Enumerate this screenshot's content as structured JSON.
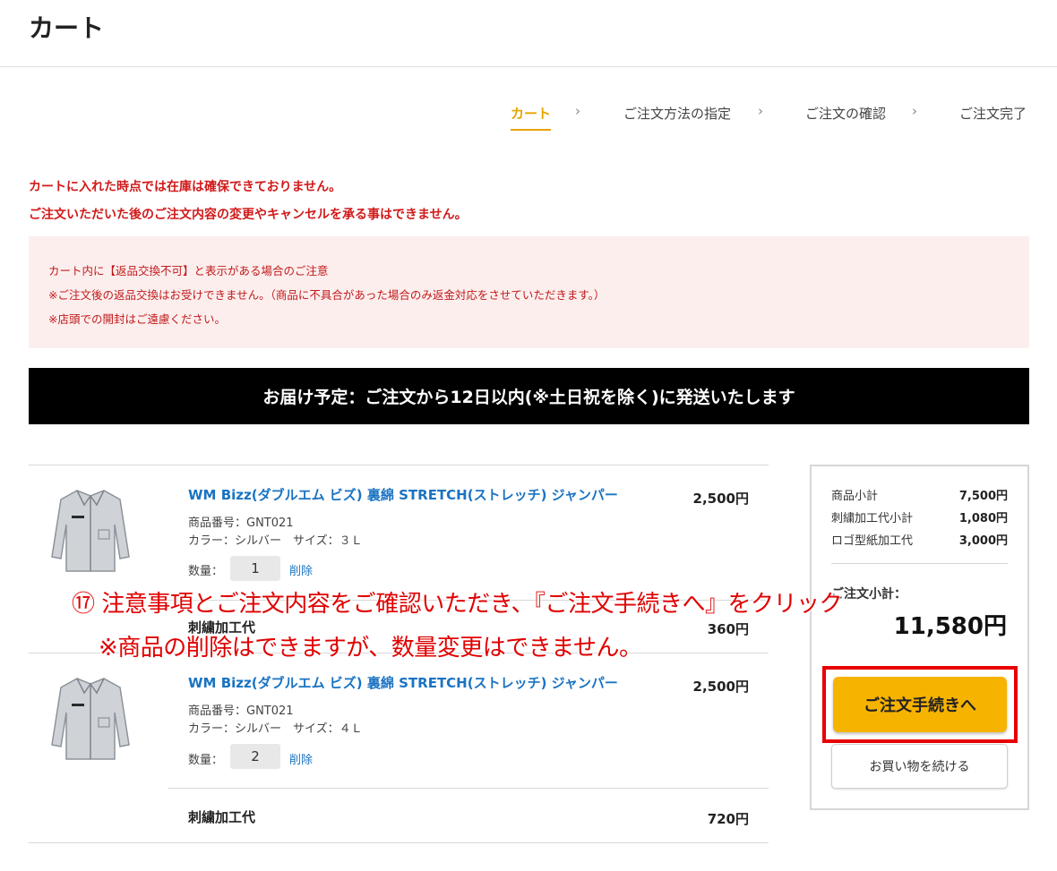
{
  "header": {
    "title": "カート"
  },
  "steps": [
    {
      "label": "カート",
      "active": true
    },
    {
      "label": "ご注文方法の指定",
      "active": false
    },
    {
      "label": "ご注文の確認",
      "active": false
    },
    {
      "label": "ご注文完了",
      "active": false
    }
  ],
  "notices": [
    "カートに入れた時点では在庫は確保できておりません。",
    "ご注文いただいた後のご注文内容の変更やキャンセルを承る事はできません。"
  ],
  "return_notice": {
    "title": "カート内に【返品交換不可】と表示がある場合のご注意",
    "lines": [
      "※ご注文後の返品交換はお受けできません。（商品に不具合があった場合のみ返金対応をさせていただきます。）",
      "※店頭での開封はご遠慮ください。"
    ]
  },
  "delivery": {
    "text": "お届け予定：ご注文から12日以内(※土日祝を除く)に発送いたします"
  },
  "items": [
    {
      "name": "WM Bizz(ダブルエム ビズ) 裏綿 STRETCH(ストレッチ) ジャンパー",
      "price": "2,500円",
      "product_code": "商品番号：GNT021",
      "color_size": "カラー：シルバー　サイズ：３Ｌ",
      "qty_label": "数量：",
      "qty": "1",
      "delete_label": "削除",
      "embroidery_label": "刺繍加工代",
      "embroidery_price": "360円"
    },
    {
      "name": "WM Bizz(ダブルエム ビズ) 裏綿 STRETCH(ストレッチ) ジャンパー",
      "price": "2,500円",
      "product_code": "商品番号：GNT021",
      "color_size": "カラー：シルバー　サイズ：４Ｌ",
      "qty_label": "数量：",
      "qty": "2",
      "delete_label": "削除",
      "embroidery_label": "刺繍加工代",
      "embroidery_price": "720円"
    }
  ],
  "summary": {
    "rows": [
      {
        "label": "商品小計",
        "value": "7,500円"
      },
      {
        "label": "刺繍加工代小計",
        "value": "1,080円"
      },
      {
        "label": "ロゴ型紙加工代",
        "value": "3,000円"
      }
    ],
    "total_label": "ご注文小計：",
    "total_value": "11,580円",
    "checkout_label": "ご注文手続きへ",
    "continue_label": "お買い物を続ける"
  },
  "annotation": {
    "line1": "⑰ 注意事項とご注文内容をご確認いただき、『ご注文手続きへ』をクリック",
    "line2": "※商品の削除はできますが、数量変更はできません。",
    "color": "#e00000"
  },
  "colors": {
    "accent": "#e8a400",
    "checkout": "#f6b300",
    "link": "#1a73c2",
    "warning": "#d11a1a",
    "highlight": "#e80000"
  }
}
